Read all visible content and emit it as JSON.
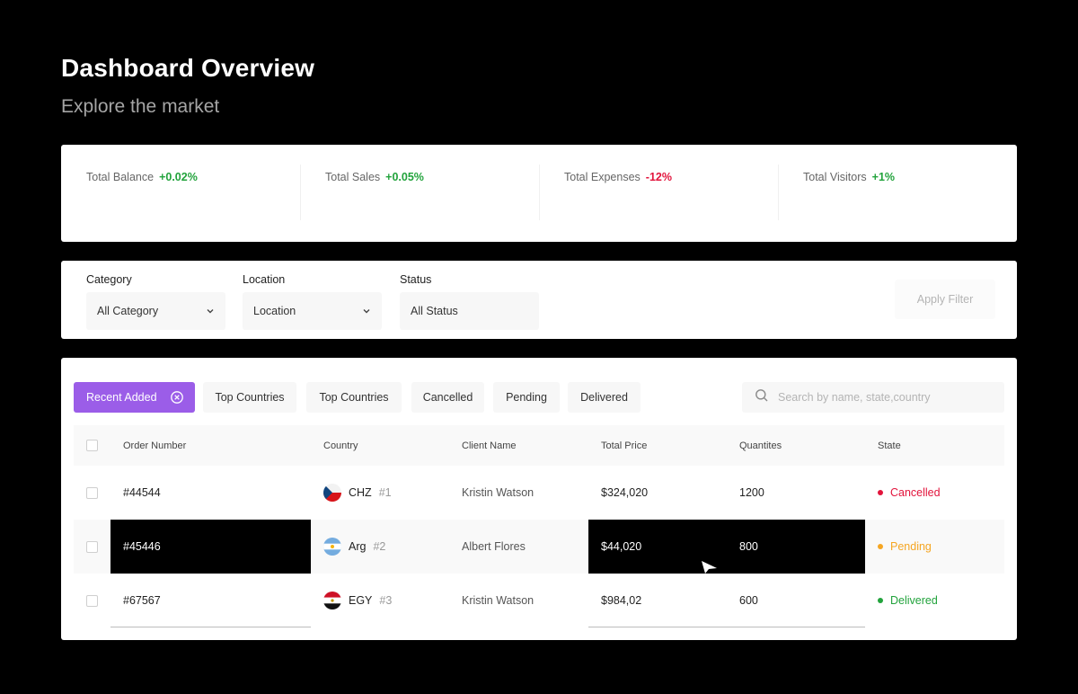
{
  "header": {
    "title": "Dashboard Overview",
    "subtitle": "Explore the market"
  },
  "stats": [
    {
      "label": "Total Balance",
      "change": "+0.02%",
      "trend": "up"
    },
    {
      "label": "Total Sales",
      "change": "+0.05%",
      "trend": "up"
    },
    {
      "label": "Total Expenses",
      "change": "-12%",
      "trend": "down"
    },
    {
      "label": "Total Visitors",
      "change": "+1%",
      "trend": "up"
    }
  ],
  "filters": {
    "category": {
      "label": "Category",
      "value": "All Category"
    },
    "location": {
      "label": "Location",
      "value": "Location"
    },
    "status": {
      "label": "Status",
      "value": "All Status"
    },
    "apply_label": "Apply Filter"
  },
  "tabs": [
    {
      "label": "Recent Added",
      "active": true
    },
    {
      "label": "Top Countries"
    },
    {
      "label": "Top Countries"
    },
    {
      "label": "Cancelled"
    },
    {
      "label": "Pending"
    },
    {
      "label": "Delivered"
    }
  ],
  "search": {
    "placeholder": "Search by name, state,country",
    "value": ""
  },
  "table": {
    "columns": [
      "Order Number",
      "Country",
      "Client Name",
      "Total Price",
      "Quantites",
      "State"
    ],
    "rows": [
      {
        "order": "#44544",
        "country": "CHZ",
        "rank": "#1",
        "client": "Kristin Watson",
        "price": "$324,020",
        "qty": "1200",
        "state": "Cancelled"
      },
      {
        "order": "#45446",
        "country": "Arg",
        "rank": "#2",
        "client": "Albert Flores",
        "price": "$44,020",
        "qty": "800",
        "state": "Pending"
      },
      {
        "order": "#67567",
        "country": "EGY",
        "rank": "#3",
        "client": "Kristin Watson",
        "price": "$984,02",
        "qty": "600",
        "state": "Delivered"
      }
    ]
  },
  "colors": {
    "accent": "#9b5de8",
    "positive": "#22a33c",
    "negative": "#e2143c",
    "cancelled": "#e2143c",
    "pending": "#f5a623",
    "delivered": "#22a33c"
  }
}
